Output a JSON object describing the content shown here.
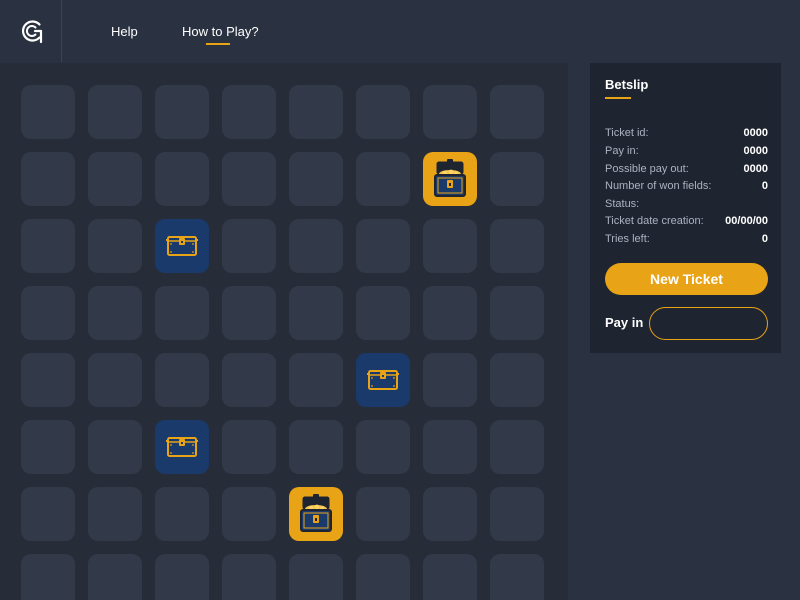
{
  "nav": {
    "help_label": "Help",
    "howto_label": "How to Play?",
    "active_tab": "How to Play?",
    "logo_icon": "g-logo-icon"
  },
  "colors": {
    "accent": "#e8a317",
    "tile": "#323a49",
    "tile_blue": "#1a3a6b",
    "board_bg": "#262d39",
    "panel_bg": "#1f2530"
  },
  "board": {
    "rows": 8,
    "cols": 8,
    "revealed": [
      {
        "row": 1,
        "col": 6,
        "type": "gold",
        "icon": "open-treasure-chest-icon"
      },
      {
        "row": 2,
        "col": 2,
        "type": "blue",
        "icon": "closed-chest-icon"
      },
      {
        "row": 4,
        "col": 5,
        "type": "blue",
        "icon": "closed-chest-icon"
      },
      {
        "row": 5,
        "col": 2,
        "type": "blue",
        "icon": "closed-chest-icon"
      },
      {
        "row": 6,
        "col": 4,
        "type": "gold",
        "icon": "open-treasure-chest-icon"
      }
    ]
  },
  "betslip": {
    "title": "Betslip",
    "rows": [
      {
        "label": "Ticket id:",
        "value": "0000"
      },
      {
        "label": "Pay in:",
        "value": "0000"
      },
      {
        "label": "Possible pay out:",
        "value": "0000"
      },
      {
        "label": "Number of won fields:",
        "value": "0"
      },
      {
        "label": "Status:",
        "value": ""
      },
      {
        "label": "Ticket date creation:",
        "value": "00/00/00"
      },
      {
        "label": "Tries left:",
        "value": "0"
      }
    ],
    "new_ticket_label": "New Ticket",
    "payin_label": "Pay in",
    "payin_value": ""
  }
}
